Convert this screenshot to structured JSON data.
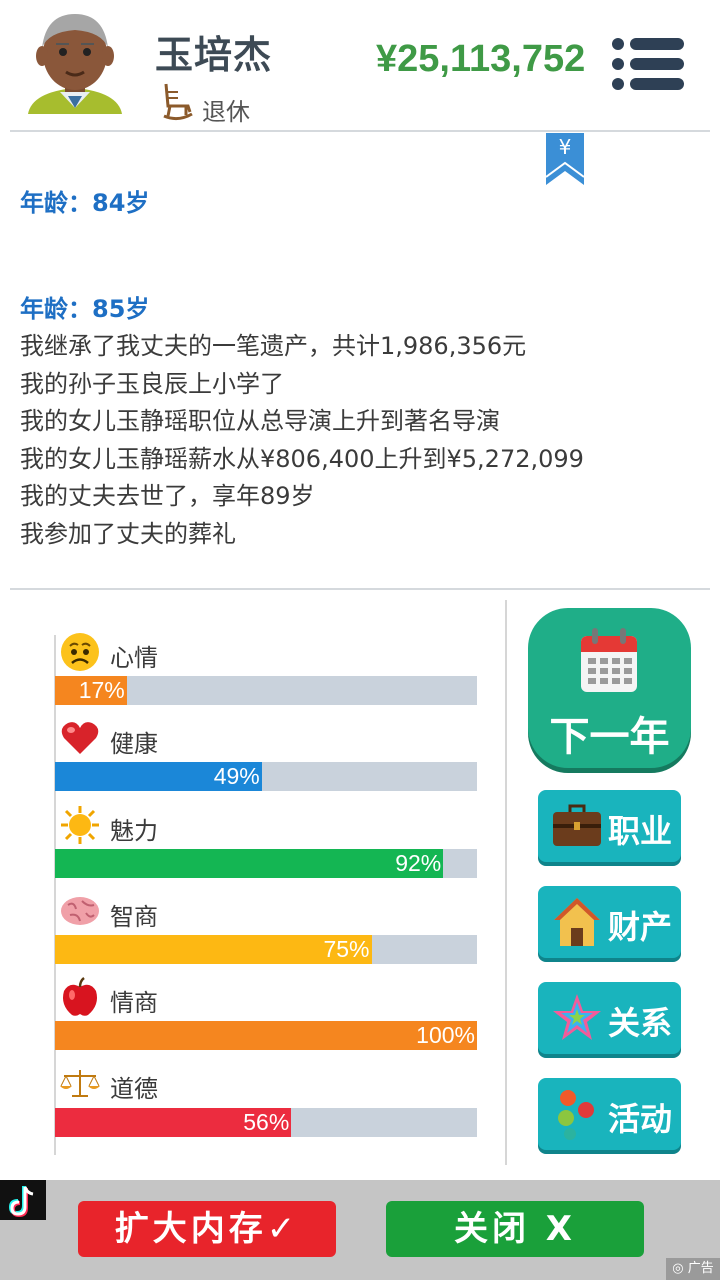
{
  "header": {
    "name": "玉培杰",
    "status": "退休",
    "money": "¥25,113,752",
    "avatar_icon": "elderly-man-avatar",
    "status_icon": "rocking-chair-icon",
    "menu_icon": "menu-icon"
  },
  "bookmark": {
    "symbol": "¥"
  },
  "log": [
    {
      "age": "年龄：84岁",
      "events": []
    },
    {
      "age": "年龄：85岁",
      "events": [
        "我继承了我丈夫的一笔遗产，共计1,986,356元",
        "我的孙子玉良辰上小学了",
        "我的女儿玉静瑶职位从总导演上升到著名导演",
        "我的女儿玉静瑶薪水从¥806,400上升到¥5,272,099",
        "我的丈夫去世了，享年89岁",
        "我参加了丈夫的葬礼"
      ]
    }
  ],
  "stats": [
    {
      "label": "心情",
      "value": 17,
      "pct": "17%",
      "color": "#f5861f",
      "icon": "sad-face-icon"
    },
    {
      "label": "健康",
      "value": 49,
      "pct": "49%",
      "color": "#1b87d8",
      "icon": "heart-icon"
    },
    {
      "label": "魅力",
      "value": 92,
      "pct": "92%",
      "color": "#14b653",
      "icon": "sun-icon"
    },
    {
      "label": "智商",
      "value": 75,
      "pct": "75%",
      "color": "#fdb813",
      "icon": "brain-icon"
    },
    {
      "label": "情商",
      "value": 100,
      "pct": "100%",
      "color": "#f5861f",
      "icon": "apple-icon"
    },
    {
      "label": "道德",
      "value": 56,
      "pct": "56%",
      "color": "#ec2c3f",
      "icon": "scales-icon"
    }
  ],
  "buttons": {
    "next_year": "下一年",
    "career": "职业",
    "assets": "财产",
    "relations": "关系",
    "activities": "活动"
  },
  "ad": {
    "expand": "扩大内存✓",
    "close": "关闭 X",
    "tag": "广告"
  }
}
